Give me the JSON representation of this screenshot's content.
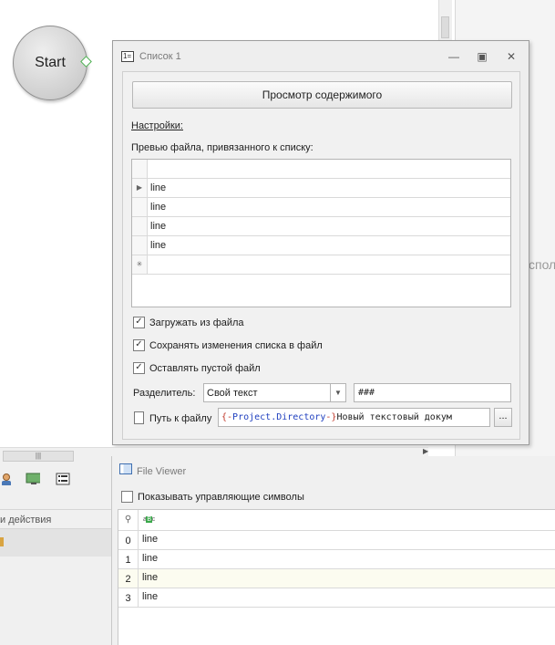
{
  "canvas": {
    "start_label": "Start",
    "right_pane_text": "спол"
  },
  "list_dialog": {
    "title": "Список 1",
    "title_icon": "list-numbered-icon",
    "view_button": "Просмотр содержимого",
    "settings_link": "Настройки:",
    "preview_label": "Превью файла, привязанного к списку:",
    "rows": [
      "line",
      "line",
      "line",
      "line"
    ],
    "new_row_marker": "✳",
    "checkboxes": {
      "load": {
        "label": "Загружать из файла",
        "checked": true
      },
      "save": {
        "label": "Сохранять изменения списка в файл",
        "checked": true
      },
      "empty": {
        "label": "Оставлять пустой файл",
        "checked": true
      }
    },
    "separator_label": "Разделитель:",
    "separator_mode": "Свой текст",
    "separator_value": "###",
    "path_label": "Путь к файлу",
    "path_tokens": {
      "brace_open": "{-",
      "variable": "Project.Directory",
      "brace_close": "-}",
      "text": "Новый текстовый докум"
    },
    "browse_button": "..."
  },
  "bottom_left": {
    "header": "и действия",
    "scroll_grip": "|||"
  },
  "file_viewer": {
    "title": "File Viewer",
    "show_control_chars": "Показывать управляющие символы",
    "show_control_chars_checked": false,
    "abc": "aBc",
    "rows": [
      {
        "num": "0",
        "text": "line"
      },
      {
        "num": "1",
        "text": "line"
      },
      {
        "num": "2",
        "text": "line"
      },
      {
        "num": "3",
        "text": "line"
      }
    ]
  }
}
